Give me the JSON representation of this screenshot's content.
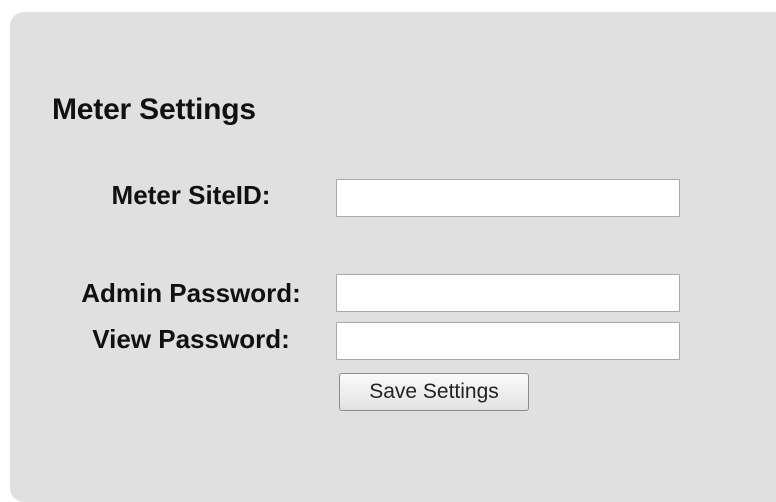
{
  "section": {
    "title": "Meter Settings"
  },
  "form": {
    "site_id": {
      "label": "Meter SiteID:",
      "value": ""
    },
    "admin_password": {
      "label": "Admin Password:",
      "value": ""
    },
    "view_password": {
      "label": "View Password:",
      "value": ""
    },
    "save_label": "Save Settings"
  },
  "colors": {
    "panel_background": "#e0e0e0",
    "input_background": "#ffffff",
    "text": "#111111"
  }
}
